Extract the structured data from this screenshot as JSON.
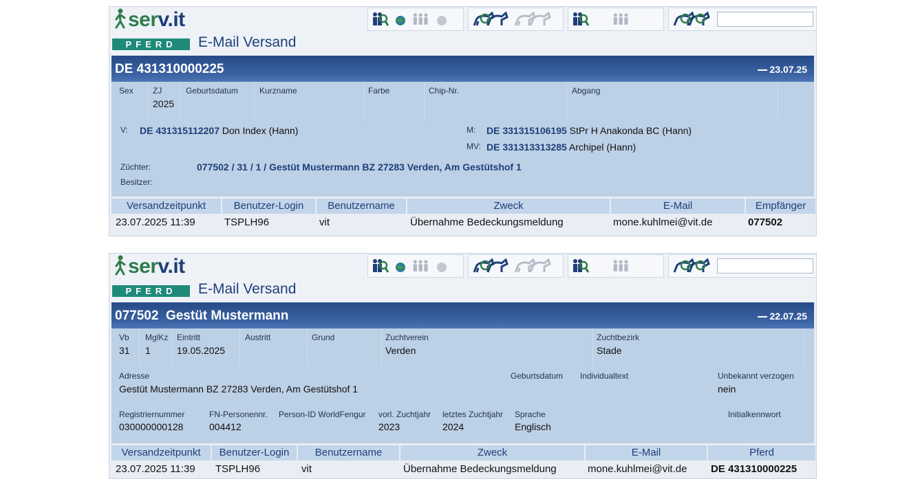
{
  "brand": {
    "logo_prefix": "ser",
    "logo_v": "v",
    "logo_suffix": ".it",
    "sub": "PFERD",
    "app_title": "E-Mail Versand"
  },
  "icons": [
    "group-search-icon",
    "globe-icon",
    "group-gray-icon",
    "globe-gray-icon",
    "horses-search-icon",
    "horses-gray-icon",
    "group-search-icon",
    "group-gray-icon",
    "horses-search-icon"
  ],
  "horse_panel": {
    "title": "DE 431310000225",
    "date": "23.07.25",
    "labels": {
      "sex": "Sex",
      "zj": "ZJ",
      "geburtsdatum": "Geburtsdatum",
      "kurzname": "Kurzname",
      "farbe": "Farbe",
      "chip": "Chip-Nr.",
      "abgang": "Abgang"
    },
    "values": {
      "zj": "2025"
    },
    "v_label": "V:",
    "v_id": "DE 431315112207",
    "v_name": "Don Index (Hann)",
    "m_label": "M:",
    "m_id": "DE 331315106195",
    "m_name": "StPr H Anakonda BC (Hann)",
    "mv_label": "MV:",
    "mv_id": "DE 331313313285",
    "mv_name": "Archipel (Hann)",
    "zuechter_label": "Züchter:",
    "zuechter": "077502 / 31 / 1 / Gestüt Mustermann BZ 27283 Verden, Am Gestütshof 1",
    "besitzer_label": "Besitzer:",
    "table": {
      "headers": [
        "Versandzeitpunkt",
        "Benutzer-Login",
        "Benutzername",
        "Zweck",
        "E-Mail",
        "Empfänger"
      ],
      "row": [
        "23.07.2025 11:39",
        "TSPLH96",
        "vit",
        "Übernahme Bedeckungsmeldung",
        "mone.kuhlmei@vit.de",
        "077502"
      ]
    }
  },
  "person_panel": {
    "title": "077502  Gestüt Mustermann",
    "date": "22.07.25",
    "labels": {
      "vb": "Vb",
      "mglkz": "MglKz",
      "eintritt": "Eintritt",
      "austritt": "Austritt",
      "grund": "Grund",
      "zuchtverein": "Zuchtverein",
      "zuchtbezirk": "Zuchtbezirk",
      "adresse": "Adresse",
      "geburtsdatum": "Geburtsdatum",
      "individualtext": "Individualtext",
      "unbekannt": "Unbekannt verzogen",
      "regnr": "Registriernummer",
      "fn": "FN-Personennr.",
      "pid": "Person-ID WorldFengur",
      "vorl": "vorl. Zuchtjahr",
      "letztes": "letztes Zuchtjahr",
      "sprache": "Sprache",
      "initial": "Initialkennwort"
    },
    "values": {
      "vb": "31",
      "mglkz": "1",
      "eintritt": "19.05.2025",
      "zuchtverein": "Verden",
      "zuchtbezirk": "Stade",
      "adresse": "Gestüt Mustermann BZ 27283 Verden, Am Gestütshof 1",
      "unbekannt": "nein",
      "regnr": "030000000128",
      "fn": "004412",
      "vorl": "2023",
      "letztes": "2024",
      "sprache": "Englisch"
    },
    "table": {
      "headers": [
        "Versandzeitpunkt",
        "Benutzer-Login",
        "Benutzername",
        "Zweck",
        "E-Mail",
        "Pferd"
      ],
      "row": [
        "23.07.2025 11:39",
        "TSPLH96",
        "vit",
        "Übernahme Bedeckungsmeldung",
        "mone.kuhlmei@vit.de",
        "DE 431310000225"
      ]
    }
  }
}
